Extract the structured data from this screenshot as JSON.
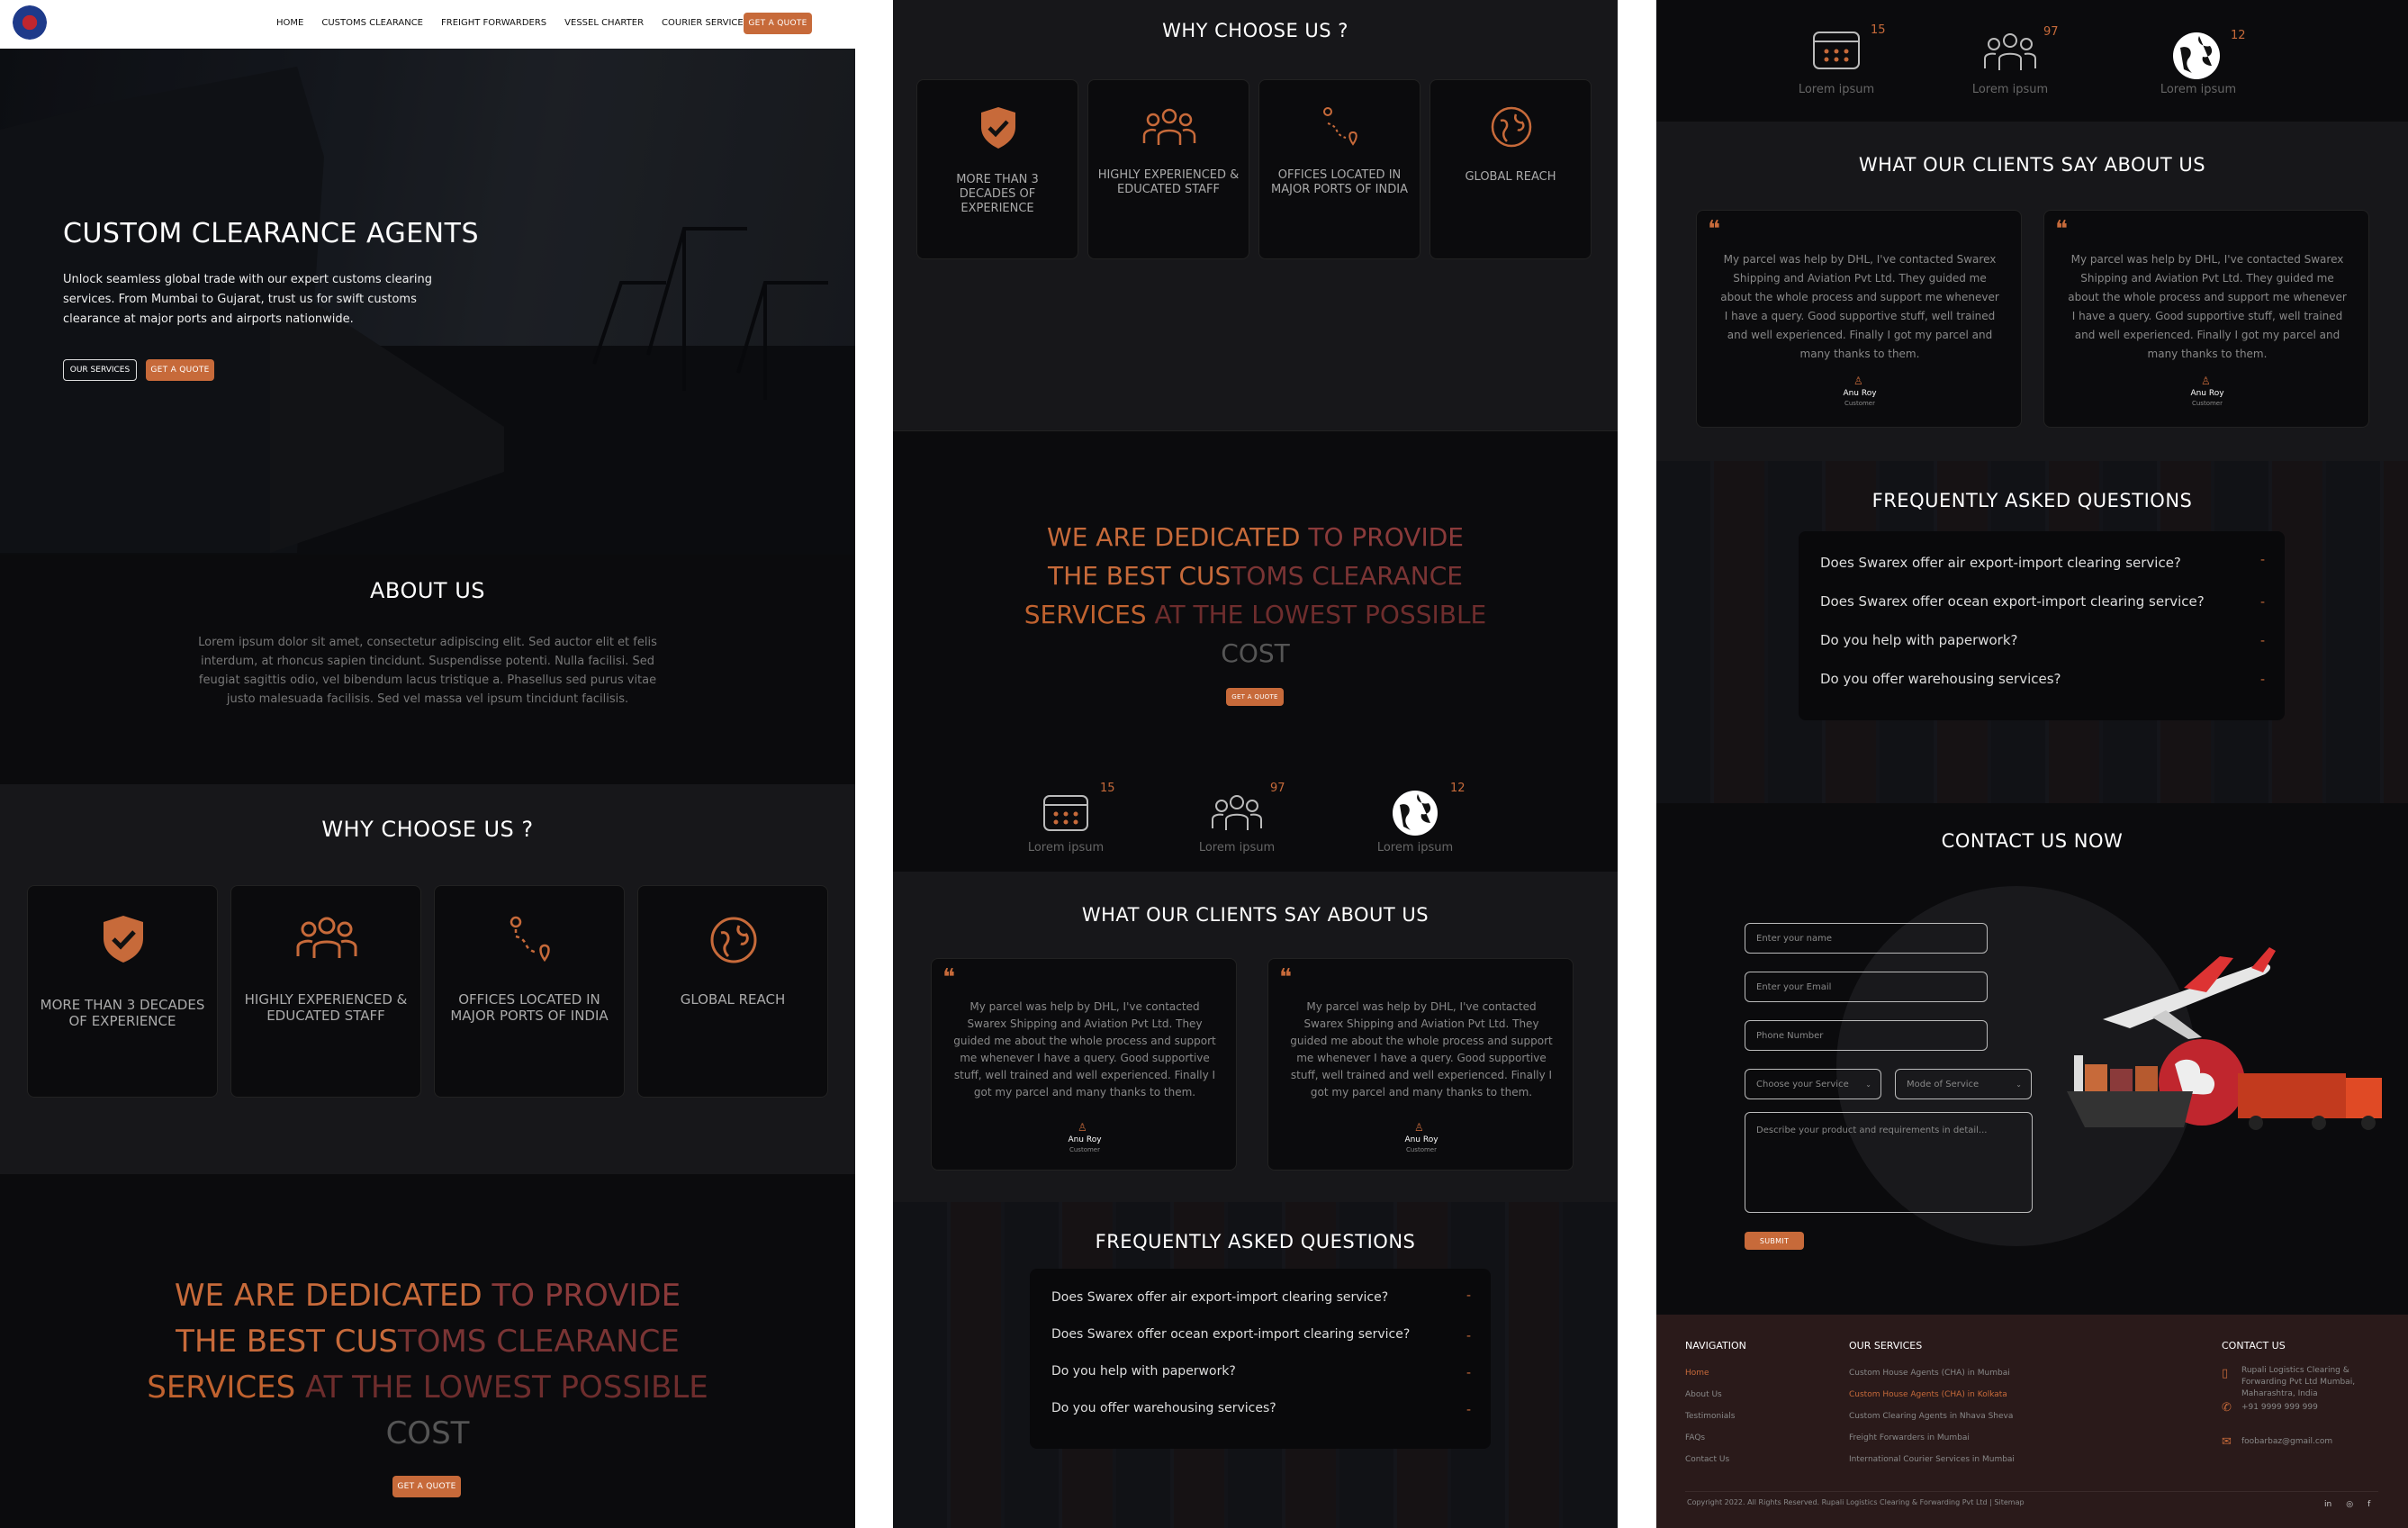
{
  "nav": {
    "items": [
      "HOME",
      "CUSTOMS CLEARANCE",
      "FREIGHT FORWARDERS",
      "VESSEL CHARTER",
      "COURIER SERVICES"
    ],
    "cta": "GET A QUOTE"
  },
  "hero": {
    "title": "CUSTOM CLEARANCE AGENTS",
    "text": "Unlock seamless global trade with our expert customs clearing services. From Mumbai to Gujarat, trust us for swift customs clearance at major ports and airports nationwide.",
    "btn1": "OUR SERVICES",
    "btn2": "GET A QUOTE"
  },
  "about": {
    "title": "ABOUT US",
    "text": "Lorem ipsum dolor sit amet, consectetur adipiscing elit. Sed auctor elit et felis interdum, at rhoncus sapien tincidunt. Suspendisse potenti. Nulla facilisi. Sed feugiat sagittis odio, vel bibendum lacus tristique a. Phasellus sed purus vitae justo malesuada facilisis. Sed vel massa vel ipsum tincidunt facilisis."
  },
  "why": {
    "title": "WHY CHOOSE US ?",
    "cards": [
      "MORE THAN 3 DECADES OF EXPERIENCE",
      "HIGHLY EXPERIENCED & EDUCATED STAFF",
      "OFFICES LOCATED IN MAJOR PORTS OF INDIA",
      "GLOBAL REACH"
    ]
  },
  "dedicated": {
    "line1a": "WE ARE DEDICATED",
    "line1b": " TO PROVIDE",
    "line2a": "THE BEST CUS",
    "line2b": "TOMS CLEARANCE",
    "line3a": "SERVICES",
    "line3b": " AT THE LOWEST POSSIBLE",
    "line4": "COST",
    "btn": "GET A QUOTE"
  },
  "stats": [
    {
      "num": "15",
      "label": "Lorem ipsum"
    },
    {
      "num": "97",
      "label": "Lorem ipsum"
    },
    {
      "num": "12",
      "label": "Lorem ipsum"
    }
  ],
  "clients": {
    "title": "WHAT OUR CLIENTS SAY ABOUT US",
    "quote": "My parcel was help by DHL, I've contacted Swarex Shipping and Aviation Pvt Ltd. They guided me about the whole process and support me whenever I have a query. Good supportive stuff, well trained and well experienced. Finally I got my parcel and many thanks to them.",
    "name": "Anu Roy",
    "role": "Customer"
  },
  "faq": {
    "title": "FREQUENTLY ASKED QUESTIONS",
    "items": [
      "Does Swarex offer air export-import clearing service?",
      "Does Swarex offer ocean export-import clearing service?",
      "Do you help with paperwork?",
      "Do you offer warehousing services?"
    ],
    "toggle": "-"
  },
  "contact": {
    "title": "CONTACT US NOW",
    "name_ph": "Enter your name",
    "email_ph": "Enter your Email",
    "phone_ph": "Phone Number",
    "service": "Choose your Service",
    "mode": "Mode of Service",
    "desc_ph": "Describe your product and requirements in detail...",
    "submit": "SUBMIT"
  },
  "footer": {
    "nav_title": "NAVIGATION",
    "nav": [
      "Home",
      "About Us",
      "Testimonials",
      "FAQs",
      "Contact Us"
    ],
    "svc_title": "OUR SERVICES",
    "svc": [
      "Custom House Agents (CHA) in Mumbai",
      "Custom House Agents (CHA) in Kolkata",
      "Custom Clearing Agents in Nhava Sheva",
      "Freight Forwarders in Mumbai",
      "International Courier Services in Mumbai"
    ],
    "contact_title": "CONTACT US",
    "address": "Rupali Logistics Clearing & Forwarding Pvt Ltd Mumbai, Maharashtra, India",
    "phone": "+91 9999 999 999",
    "email": "foobarbaz@gmail.com",
    "copyright": "Copyright 2022. All Rights Reserved. Rupali Logistics Clearing & Forwarding Pvt Ltd | Sitemap",
    "social": [
      "in",
      "◎",
      "f"
    ]
  },
  "colors": {
    "accent": "#c76a3a",
    "bg": "#0d0d0f",
    "footer": "#2a1a1a"
  }
}
